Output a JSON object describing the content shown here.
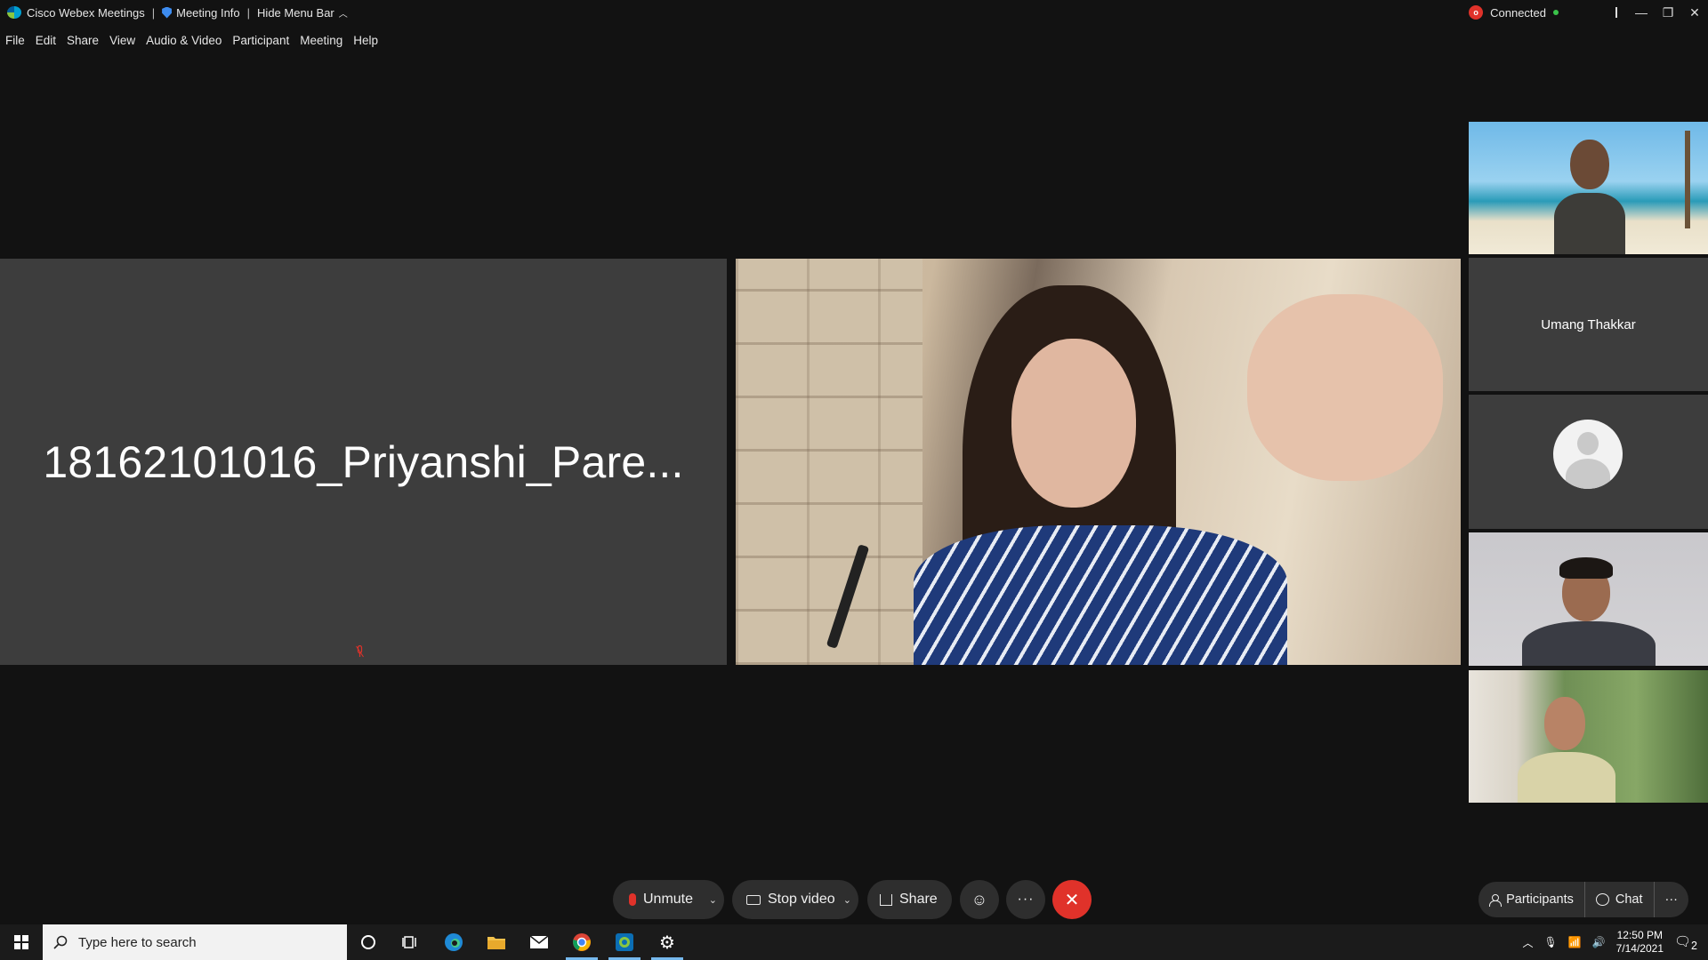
{
  "titlebar": {
    "app_name": "Cisco Webex Meetings",
    "separator": "|",
    "meeting_info": "Meeting Info",
    "hide_menu_bar": "Hide Menu Bar",
    "status": "Connected"
  },
  "menu": [
    "File",
    "Edit",
    "Share",
    "View",
    "Audio & Video",
    "Participant",
    "Meeting",
    "Help"
  ],
  "stage": {
    "left_participant_name": "18162101016_Priyanshi_Pare...",
    "sidebar_name": "Umang Thakkar"
  },
  "controls": {
    "unmute": "Unmute",
    "stop_video": "Stop video",
    "share": "Share",
    "more": "···",
    "leave": "✕",
    "participants": "Participants",
    "chat": "Chat",
    "right_more": "···"
  },
  "taskbar": {
    "search_placeholder": "Type here to search",
    "time": "12:50 PM",
    "date": "7/14/2021",
    "notification_count": "2"
  },
  "colors": {
    "accent_red": "#e0322a",
    "tile_gray": "#3d3d3d",
    "background": "#121212"
  }
}
